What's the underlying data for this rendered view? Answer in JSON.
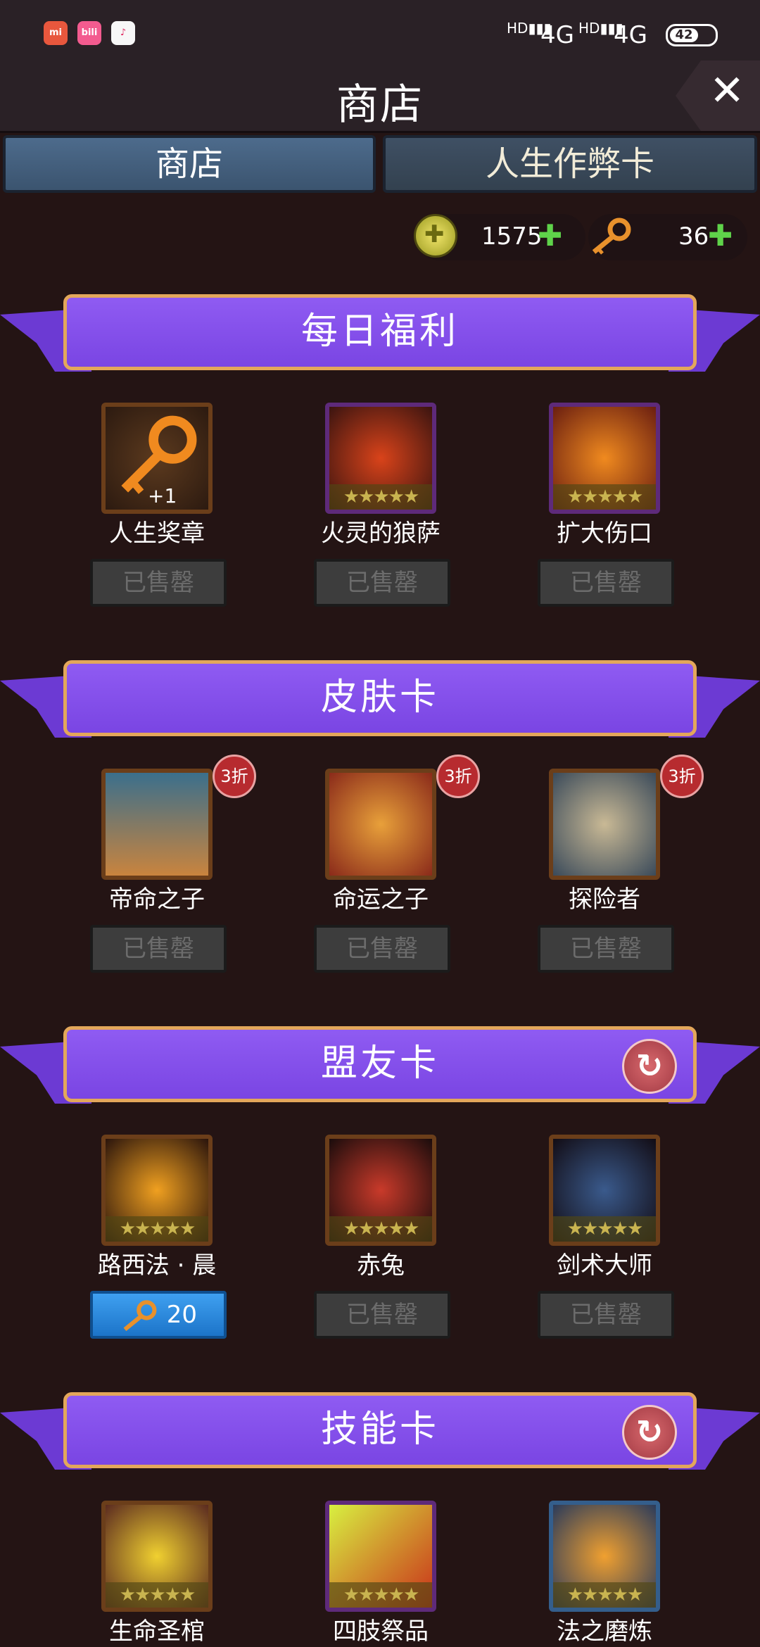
{
  "status_bar": {
    "apps": [
      "mi",
      "bilibili",
      "tiktok"
    ],
    "signal1": "4G",
    "signal2": "4G",
    "battery": "42"
  },
  "header": {
    "title": "商店"
  },
  "tabs": [
    "商店",
    "人生作弊卡"
  ],
  "currency": {
    "coins": "1575",
    "keys": "36",
    "plus": "+"
  },
  "sections": [
    {
      "title": "每日福利",
      "items": [
        {
          "name": "人生奖章",
          "button": "已售罄",
          "qty": "+1"
        },
        {
          "name": "火灵的狼萨",
          "button": "已售罄"
        },
        {
          "name": "扩大伤口",
          "button": "已售罄"
        }
      ]
    },
    {
      "title": "皮肤卡",
      "items": [
        {
          "name": "帝命之子",
          "button": "已售罄",
          "discount": "3折"
        },
        {
          "name": "命运之子",
          "button": "已售罄",
          "discount": "3折"
        },
        {
          "name": "探险者",
          "button": "已售罄",
          "discount": "3折"
        }
      ]
    },
    {
      "title": "盟友卡",
      "items": [
        {
          "name": "路西法 · 晨",
          "button": "20"
        },
        {
          "name": "赤兔",
          "button": "已售罄"
        },
        {
          "name": "剑术大师",
          "button": "已售罄"
        }
      ]
    },
    {
      "title": "技能卡",
      "items": [
        {
          "name": "生命圣棺"
        },
        {
          "name": "四肢祭品"
        },
        {
          "name": "法之磨炼"
        }
      ]
    }
  ],
  "stars_text": "★★★★★",
  "colors": {
    "background": "#241414",
    "banner": "#8f5bf2",
    "banner_border": "#e3a75b",
    "price_button": "#2a8ae0"
  }
}
